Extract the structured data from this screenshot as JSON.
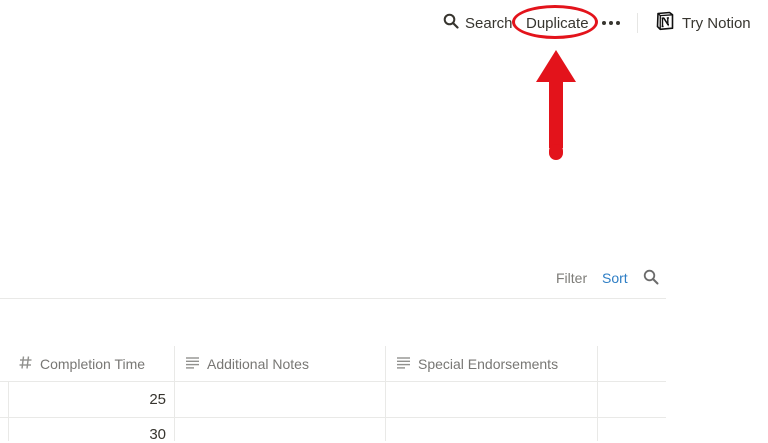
{
  "topbar": {
    "search_label": "Search",
    "duplicate_label": "Duplicate",
    "more_icon": "more-horizontal-icon",
    "try_label": "Try Notion",
    "logo_icon": "notion-logo-icon"
  },
  "annotation": {
    "highlight_color": "#e3131b"
  },
  "view_toolbar": {
    "filter_label": "Filter",
    "sort_label": "Sort",
    "sort_color": "#2e7ec5"
  },
  "table": {
    "columns": [
      {
        "label": "Completion Time",
        "icon": "number-hash-icon"
      },
      {
        "label": "Additional Notes",
        "icon": "text-lines-icon"
      },
      {
        "label": "Special Endorsements",
        "icon": "text-lines-icon"
      }
    ],
    "rows": [
      {
        "completion_time": "25"
      },
      {
        "completion_time": "30"
      }
    ]
  }
}
